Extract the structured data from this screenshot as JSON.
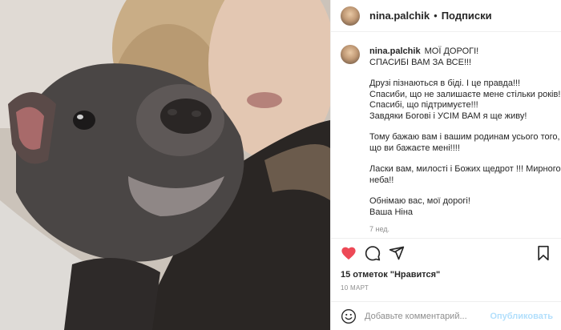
{
  "post": {
    "username": "nina.palchik",
    "separator": "•",
    "follow_label": "Подписки"
  },
  "caption": {
    "username": "nina.palchik",
    "paragraphs": [
      "МОЇ ДОРОГІ!",
      "СПАСИБІ ВАМ ЗА ВСЕ!!!",
      "Друзі пізнаються в біді. І це правда!!!",
      "Спасиби, що не залишаєте мене стільки років!",
      "Спасибі, що підтримуєте!!!",
      "Завдяки Богові і УСІМ ВАМ я ще живу!",
      "Тому бажаю вам і вашим родинам усього того,",
      "що ви бажаєте мені!!!!",
      "Ласки вам, милості і Божих щедрот !!! Мирного",
      "неба!!",
      "Обнімаю вас, мої дорогі!",
      "Ваша Ніна"
    ],
    "time_ago": "7 нед."
  },
  "actions": {
    "like_icon": "heart-icon",
    "comment_icon": "comment-icon",
    "share_icon": "share-icon",
    "save_icon": "bookmark-icon",
    "like_color": "#ed4956"
  },
  "likes_text": "15 отметок \"Нравится\"",
  "date_text": "10 МАРТ",
  "comment": {
    "placeholder": "Добавьте комментарий...",
    "publish_label": "Опубликовать",
    "emoji_icon": "smiley-icon"
  }
}
